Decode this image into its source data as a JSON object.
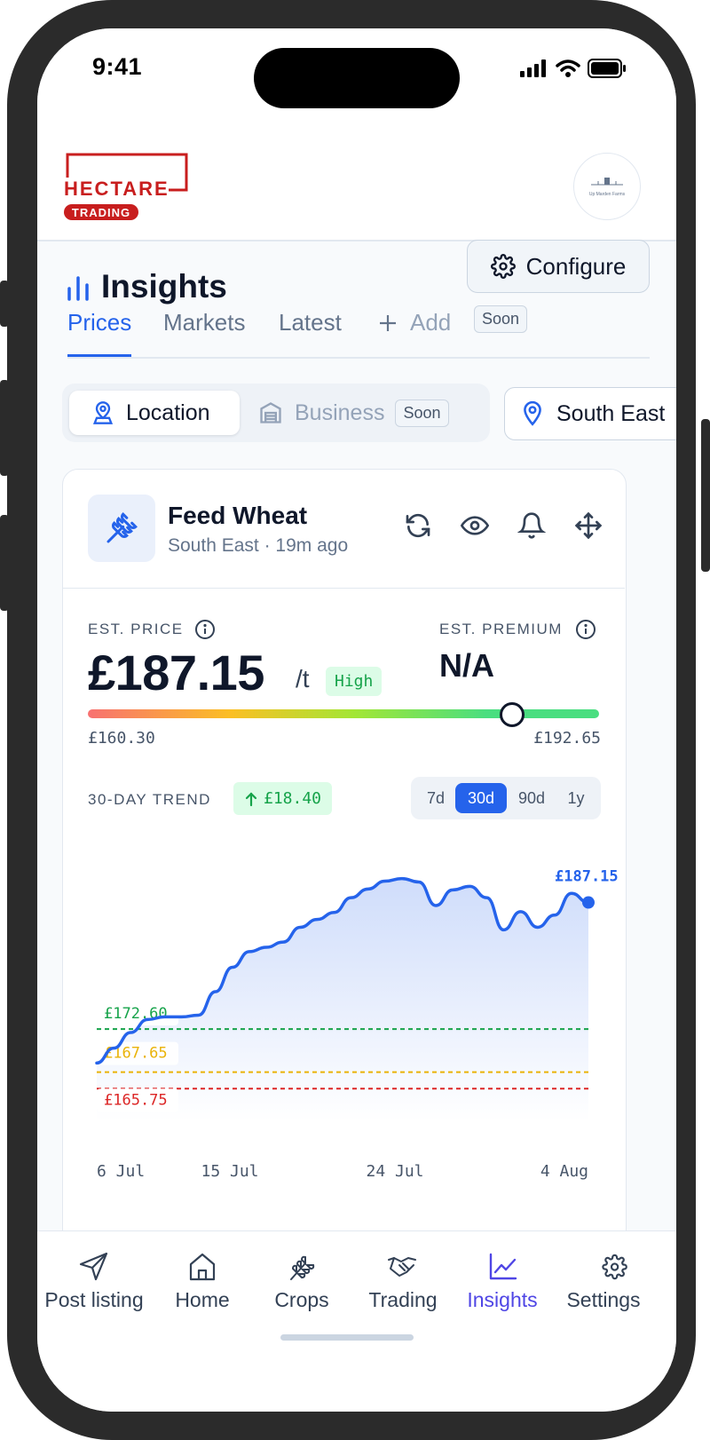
{
  "status_bar": {
    "time": "9:41"
  },
  "brand": {
    "logo_text": "HECTARE",
    "logo_subtext": "TRADING",
    "avatar_text": "Up Marden Farms",
    "accent": "#c81e1e"
  },
  "page": {
    "title": "Insights",
    "configure_label": "Configure"
  },
  "tabs": [
    {
      "label": "Prices",
      "active": true
    },
    {
      "label": "Markets",
      "active": false
    },
    {
      "label": "Latest",
      "active": false
    },
    {
      "label": "Add",
      "active": false,
      "badge": "Soon"
    }
  ],
  "filters": {
    "location_label": "Location",
    "business_label": "Business",
    "business_badge": "Soon",
    "region_label": "South East"
  },
  "card": {
    "crop_name": "Feed Wheat",
    "crop_meta": "South East · 19m ago",
    "est_price_label": "EST. PRICE",
    "price": "£187.15",
    "price_unit": "/t",
    "price_badge": "High",
    "est_premium_label": "EST. PREMIUM",
    "premium": "N/A",
    "range_min": "£160.30",
    "range_max": "£192.65",
    "range_position": 0.83,
    "trend_label": "30-DAY TREND",
    "trend_value": "£18.40",
    "range_options": [
      "7d",
      "30d",
      "90d",
      "1y"
    ],
    "range_selected": "30d"
  },
  "chart_data": {
    "type": "area",
    "x_tick_labels": [
      "6 Jul",
      "15 Jul",
      "24 Jul",
      "4 Aug"
    ],
    "ylim": [
      162,
      192
    ],
    "series": [
      {
        "values": [
          168.7,
          170.4,
          172.2,
          173.7,
          174.0,
          174.0,
          174.2,
          176.9,
          179.7,
          181.5,
          182.0,
          182.6,
          184.3,
          185.2,
          186.0,
          187.7,
          188.7,
          189.6,
          189.9,
          189.5,
          186.8,
          188.6,
          189.0,
          187.7,
          184.0,
          186.1,
          184.3,
          185.7,
          188.2,
          187.15
        ]
      }
    ],
    "reference_lines": [
      {
        "label": "£172.60",
        "value": 172.6,
        "color": "#16a34a"
      },
      {
        "label": "£167.65",
        "value": 167.65,
        "color": "#eab308"
      },
      {
        "label": "£165.75",
        "value": 165.75,
        "color": "#dc2626"
      }
    ],
    "last_point_label": "£187.15",
    "line_color": "#2563eb",
    "grid": false
  },
  "nav": [
    {
      "label": "Post listing",
      "icon": "send-icon",
      "active": false
    },
    {
      "label": "Home",
      "icon": "home-icon",
      "active": false
    },
    {
      "label": "Crops",
      "icon": "wheat-icon",
      "active": false
    },
    {
      "label": "Trading",
      "icon": "handshake-icon",
      "active": false
    },
    {
      "label": "Insights",
      "icon": "line-chart-icon",
      "active": true
    },
    {
      "label": "Settings",
      "icon": "gear-icon",
      "active": false
    }
  ]
}
